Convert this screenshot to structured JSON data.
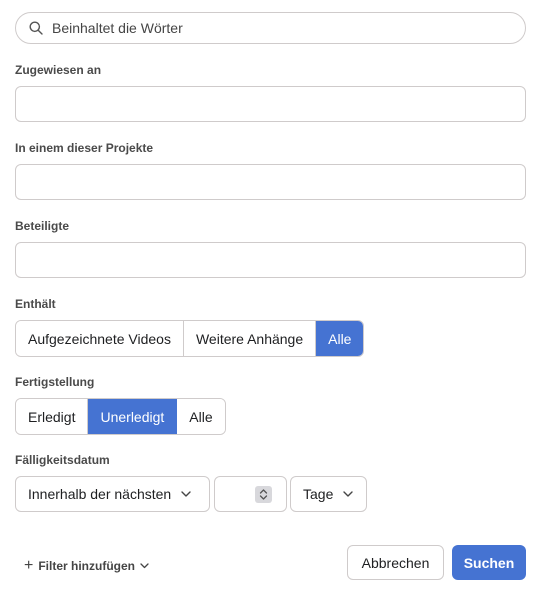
{
  "search": {
    "placeholder": "Beinhaltet die Wörter",
    "icon": "search-icon"
  },
  "fields": {
    "assigned_label": "Zugewiesen an",
    "projects_label": "In einem dieser Projekte",
    "collaborators_label": "Beteiligte"
  },
  "contains": {
    "label": "Enthält",
    "options": [
      "Aufgezeichnete Videos",
      "Weitere Anhänge",
      "Alle"
    ],
    "selected": "Alle"
  },
  "completion": {
    "label": "Fertigstellung",
    "options": [
      "Erledigt",
      "Unerledigt",
      "Alle"
    ],
    "selected": "Unerledigt"
  },
  "due_date": {
    "label": "Fälligkeitsdatum",
    "range_select": "Innerhalb der nächsten",
    "number_value": "",
    "unit_select": "Tage"
  },
  "footer": {
    "add_filter": "Filter hinzufügen",
    "cancel": "Abbrechen",
    "search": "Suchen"
  },
  "colors": {
    "accent": "#4573d2",
    "border": "#cfcbcb",
    "text": "#1e1f21"
  }
}
